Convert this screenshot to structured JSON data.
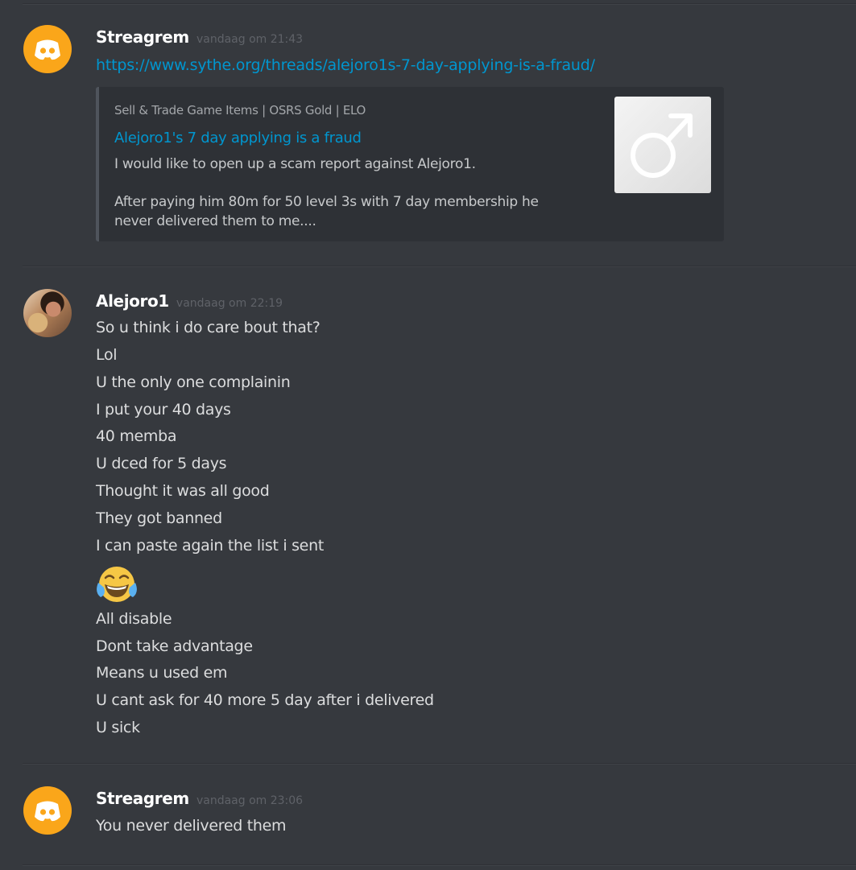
{
  "messages": [
    {
      "author": "Streagrem",
      "timestamp": "vandaag om 21:43",
      "link": "https://www.sythe.org/threads/alejoro1s-7-day-applying-is-a-fraud/",
      "embed": {
        "provider": "Sell & Trade Game Items | OSRS Gold | ELO",
        "title": "Alejoro1's 7 day applying is a fraud",
        "description_line1": "I would like to open up a scam report against Alejoro1.",
        "description_line2": "After paying him 80m for 50 level 3s with 7 day membership he",
        "description_line3": "never delivered them to me....",
        "thumbnail_icon": "male-symbol-icon"
      }
    },
    {
      "author": "Alejoro1",
      "timestamp": "vandaag om 22:19",
      "lines": [
        "So u think i do care bout that?",
        "Lol",
        "U the only one complainin",
        "I put your 40 days",
        "40 memba",
        "U dced for 5 days",
        "Thought it was all good",
        "They got banned",
        "I can paste again the list i sent",
        "😂",
        "All disable",
        "Dont take advantage",
        "Means u used em",
        "U cant ask for 40 more 5 day after i delivered",
        "U sick"
      ]
    },
    {
      "author": "Streagrem",
      "timestamp": "vandaag om 23:06",
      "lines": [
        "You never delivered them"
      ]
    }
  ],
  "colors": {
    "background": "#36393e",
    "link": "#0096cf",
    "discord_avatar": "#faa61a"
  }
}
